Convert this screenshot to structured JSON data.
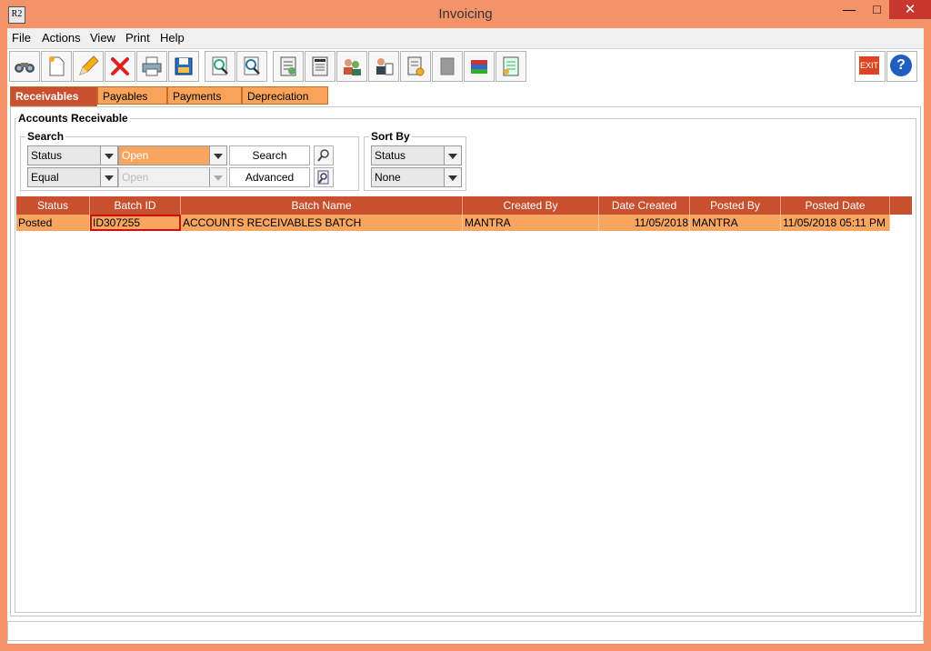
{
  "window": {
    "title": "Invoicing",
    "app_icon": "R2",
    "minimize": "—",
    "maximize": "□",
    "close": "✕"
  },
  "menu": [
    "File",
    "Actions",
    "View",
    "Print",
    "Help"
  ],
  "toolbar": {
    "buttons": [
      "binoculars-icon",
      "new-document-icon",
      "pencil-icon",
      "delete-x-icon",
      "printer-icon",
      "save-disk-icon",
      "search-document-icon",
      "search-document-alt-icon",
      "batch-report-icon",
      "batch-icon",
      "users-icon",
      "user-report-icon",
      "report-coins-icon",
      "document-disabled-icon",
      "books-icon",
      "document-list-icon"
    ],
    "exit_label": "EXIT",
    "help_label": "?"
  },
  "tabs": [
    "Receivables",
    "Payables",
    "Payments",
    "Depreciation"
  ],
  "panel": {
    "title": "Accounts Receivable",
    "search": {
      "title": "Search",
      "field": "Status",
      "value": "Open",
      "operator": "Equal",
      "value2": "Open",
      "search_button": "Search",
      "advanced_button": "Advanced"
    },
    "sort": {
      "title": "Sort By",
      "field": "Status",
      "order": "None"
    }
  },
  "grid": {
    "columns": [
      "Status",
      "Batch ID",
      "Batch Name",
      "Created By",
      "Date Created",
      "Posted By",
      "Posted Date"
    ],
    "rows": [
      [
        "Posted",
        "ID307255",
        "ACCOUNTS RECEIVABLES BATCH",
        "MANTRA",
        "11/05/2018",
        "MANTRA",
        "11/05/2018 05:11 PM"
      ]
    ]
  },
  "colors": {
    "accent": "#c8502e",
    "row": "#f7a55f",
    "frame": "#f4936a",
    "selection": "#d01010"
  }
}
